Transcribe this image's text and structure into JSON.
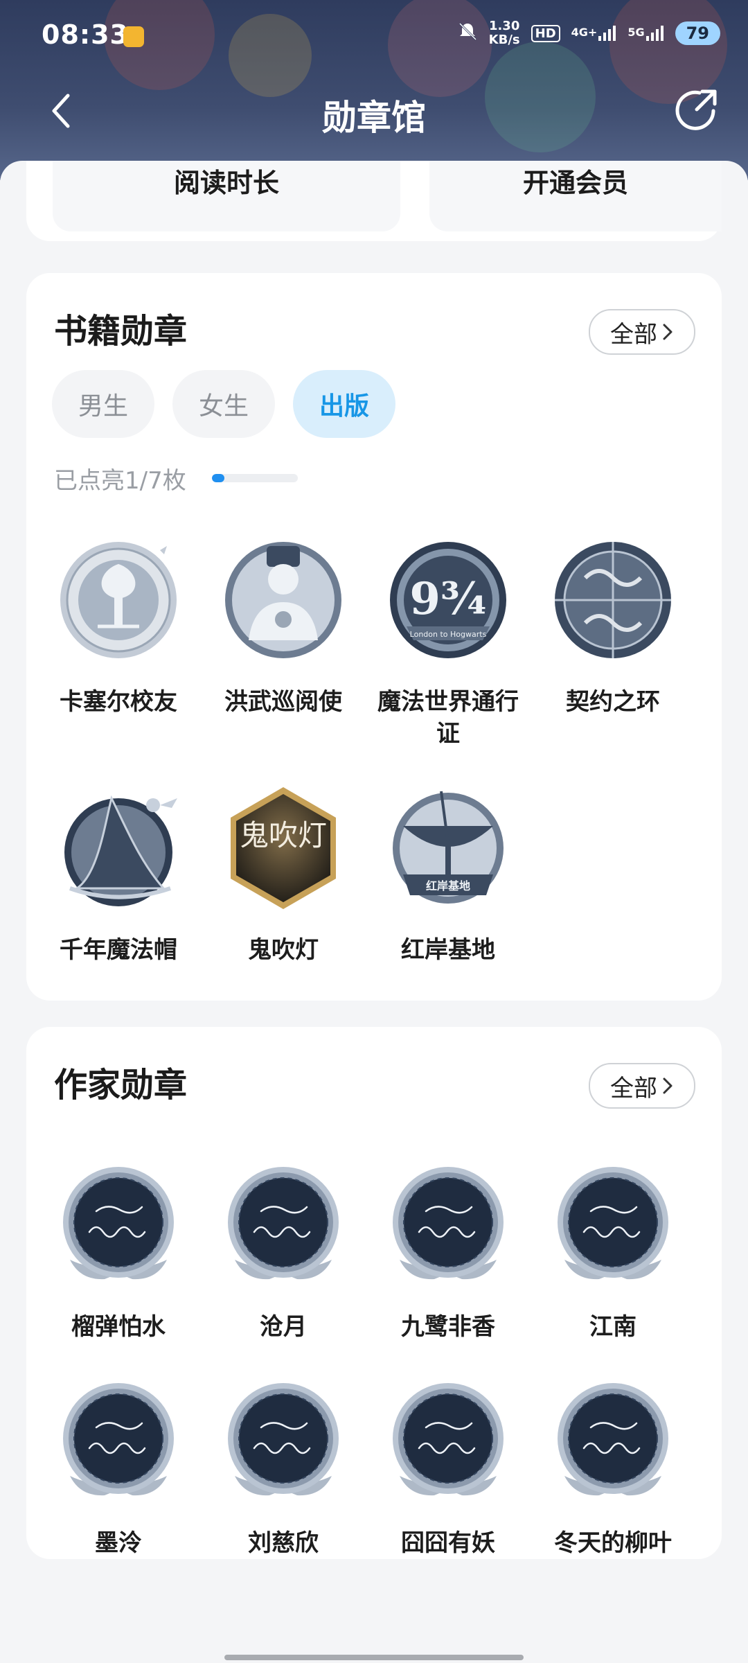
{
  "status_bar": {
    "time": "08:33",
    "net_speed_value": "1.30",
    "net_speed_unit": "KB/s",
    "hd_label": "HD",
    "lte_label": "4G+",
    "fiveg_label": "5G",
    "battery": "79"
  },
  "nav": {
    "title": "勋章馆",
    "back_icon": "chevron-left-icon",
    "share_icon": "share-icon"
  },
  "top_tiles": [
    {
      "label": "阅读时长"
    },
    {
      "label": "开通会员"
    }
  ],
  "book_section": {
    "title": "书籍勋章",
    "all_label": "全部",
    "tabs": [
      {
        "label": "男生",
        "active": false
      },
      {
        "label": "女生",
        "active": false
      },
      {
        "label": "出版",
        "active": true
      }
    ],
    "progress_text": "已点亮1/7枚",
    "progress": {
      "lit": 1,
      "total": 7
    },
    "badges": [
      {
        "name": "卡塞尔校友"
      },
      {
        "name": "洪武巡阅使"
      },
      {
        "name": "魔法世界通行证",
        "emblem_text": "London to Hogwarts"
      },
      {
        "name": "契约之环"
      },
      {
        "name": "千年魔法帽"
      },
      {
        "name": "鬼吹灯",
        "emblem_text": "鬼吹灯"
      },
      {
        "name": "红岸基地",
        "emblem_text": "红岸基地"
      }
    ]
  },
  "writer_section": {
    "title": "作家勋章",
    "all_label": "全部",
    "badges": [
      {
        "name": "榴弹怕水"
      },
      {
        "name": "沧月"
      },
      {
        "name": "九鹭非香"
      },
      {
        "name": "江南"
      },
      {
        "name": "墨泠"
      },
      {
        "name": "刘慈欣"
      },
      {
        "name": "囧囧有妖"
      },
      {
        "name": "冬天的柳叶"
      }
    ]
  },
  "colors": {
    "accent": "#1796e6",
    "header_bg": "#36446a",
    "tab_active_bg": "#d9eefc"
  }
}
